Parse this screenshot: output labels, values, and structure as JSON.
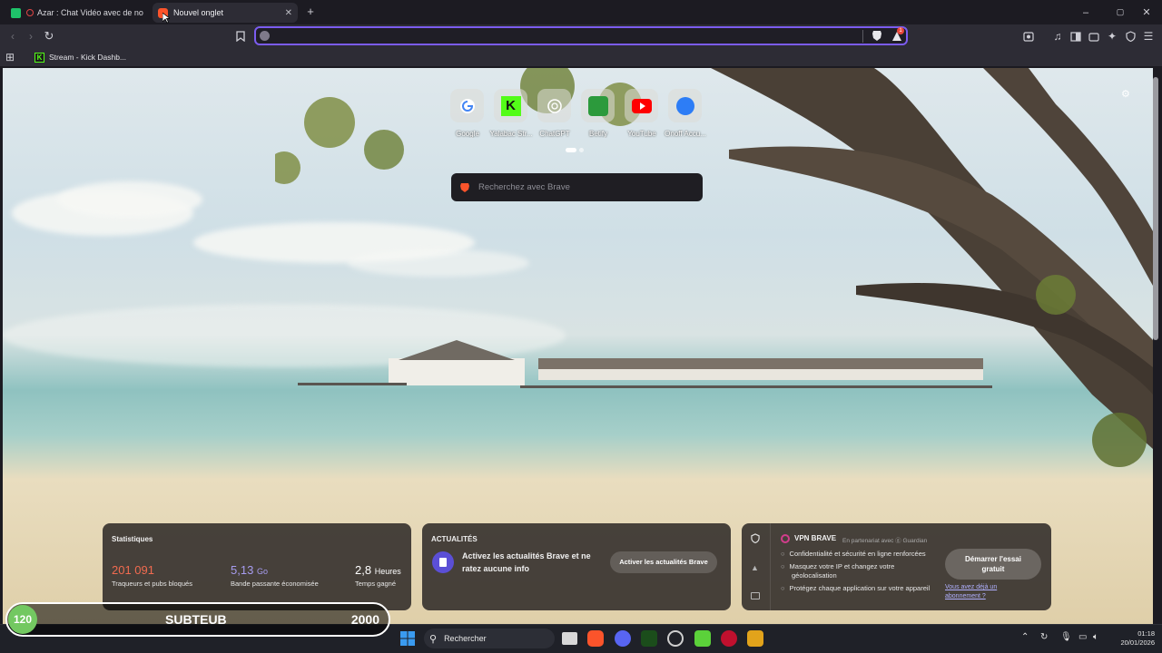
{
  "tabs": [
    {
      "title": "Azar : Chat Vidéo avec de nouvell",
      "active": false
    },
    {
      "title": "Nouvel onglet",
      "active": true
    }
  ],
  "new_tab_icon": "plus-icon",
  "window_controls": {
    "minimize": "–",
    "maximize": "▢",
    "close": "✕"
  },
  "bookmarks": [
    {
      "label": "Stream - Kick Dashb..."
    }
  ],
  "top_sites": [
    {
      "label": "Google",
      "color": "#ffffff"
    },
    {
      "label": "Yalabac Str...",
      "color": "#2e8b2e"
    },
    {
      "label": "ChatGPT",
      "color": "#9a9a94"
    },
    {
      "label": "Betify",
      "color": "#3a9a3a"
    },
    {
      "label": "YouTube",
      "color": "#ff0000"
    },
    {
      "label": "Onoff Accu...",
      "color": "#2d7df6"
    }
  ],
  "search": {
    "placeholder": "Recherchez avec Brave"
  },
  "stats": {
    "title": "Statistiques",
    "items": [
      {
        "value": "201 091",
        "unit": "",
        "label": "Traqueurs et pubs bloqués",
        "color": "#f26b50"
      },
      {
        "value": "5,13",
        "unit": "Go",
        "label": "Bande passante économisée",
        "color": "#a79cf0"
      },
      {
        "value": "2,8",
        "unit": "Heures",
        "label": "Temps gagné",
        "color": "#ffffff"
      }
    ]
  },
  "news": {
    "title": "ACTUALITÉS",
    "text": "Activez les actualités Brave et ne ratez aucune info",
    "button": "Activer les actualités Brave"
  },
  "vpn": {
    "title": "VPN BRAVE",
    "partner": "En partenariat avec",
    "partner_name": "Guardian",
    "items": [
      "Confidentialité et sécurité en ligne renforcées",
      "Masquez votre IP et changez votre géolocalisation",
      "Protégez chaque application sur votre appareil"
    ],
    "button": "Démarrer l'essai gratuit",
    "link": "Vous avez déjà un abonnement ?"
  },
  "overlay": {
    "left": "120",
    "center": "SUBTEUB",
    "right": "2000"
  },
  "taskbar": {
    "search_label": "Rechercher",
    "time": "01:18",
    "date": "20/01/2026"
  },
  "notification_badge": "1"
}
